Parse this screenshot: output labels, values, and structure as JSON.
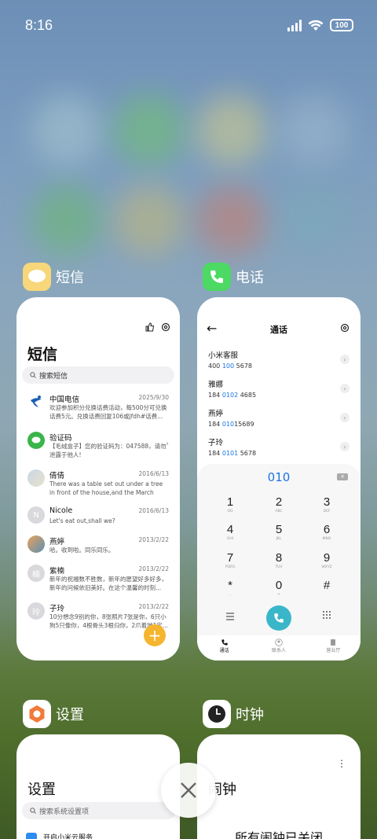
{
  "status_bar": {
    "time": "8:16",
    "battery": "100"
  },
  "apps": [
    {
      "name": "短信",
      "icon": "message-icon",
      "screen": {
        "title": "短信",
        "search_placeholder": "搜索短信",
        "messages": [
          {
            "name": "中国电信",
            "date": "2025/9/30",
            "preview": "欢迎参加积分兑换话费活动，每500分可兑换话费5元。兑换话费回复106或jfdh#话费..."
          },
          {
            "name": "验证码",
            "date": "",
            "preview": "【毛绒盒子】您的验证码为：047588，请勿泄露于他人!"
          },
          {
            "name": "倩倩",
            "date": "2016/6/13",
            "preview": "There was a table set out under a tree in front of the house,and the March Hare an..."
          },
          {
            "name": "Nicole",
            "date": "2016/6/13",
            "preview": "Let's eat out,shall we?"
          },
          {
            "name": "燕婷",
            "date": "2013/2/22",
            "preview": "哈。收到啦。同乐同乐。"
          },
          {
            "name": "紫楠",
            "date": "2013/2/22",
            "preview": "新年的祝福数不胜数，新年的愿望好多好多，新年的问候依旧美好。在这个温馨的时刻..."
          },
          {
            "name": "子玲",
            "date": "2013/2/22",
            "preview": "10分想念9别的你，8张照片7张是你，6只小狗5只像你，4根骨头3根归你，2爪着地1定..."
          }
        ],
        "avatar_initials": {
          "nicole": "N",
          "zinan": "楠",
          "ziling": "玲"
        }
      }
    },
    {
      "name": "电话",
      "icon": "phone-icon",
      "screen": {
        "title": "通话",
        "contacts": [
          {
            "name": "小米客服",
            "pre": "400 ",
            "hl": "100",
            "post": " 5678"
          },
          {
            "name": "雅娜",
            "pre": "184 ",
            "hl": "0102",
            "post": " 4685"
          },
          {
            "name": "燕婷",
            "pre": "184 ",
            "hl": "010",
            "post": "15689"
          },
          {
            "name": "子玲",
            "pre": "184 ",
            "hl": "0101",
            "post": " 5678"
          }
        ],
        "dialed": "010",
        "keys": [
          {
            "d": "1",
            "l": "QO"
          },
          {
            "d": "2",
            "l": "ABC"
          },
          {
            "d": "3",
            "l": "DEF"
          },
          {
            "d": "4",
            "l": "GHI"
          },
          {
            "d": "5",
            "l": "JKL"
          },
          {
            "d": "6",
            "l": "MNO"
          },
          {
            "d": "7",
            "l": "PQRS"
          },
          {
            "d": "8",
            "l": "TUV"
          },
          {
            "d": "9",
            "l": "WXYZ"
          },
          {
            "d": "*",
            "l": ","
          },
          {
            "d": "0",
            "l": "+"
          },
          {
            "d": "#",
            "l": ""
          }
        ],
        "tabs": [
          "通话",
          "联系人",
          "营业厅"
        ]
      }
    },
    {
      "name": "设置",
      "icon": "settings-icon",
      "screen": {
        "title": "设置",
        "search_placeholder": "搜索系统设置项",
        "first_row": "开启小米云服务"
      }
    },
    {
      "name": "时钟",
      "icon": "clock-icon",
      "screen": {
        "title": "闹钟",
        "status": "所有闹钟已关闭"
      }
    }
  ],
  "colors": {
    "accent_blue": "#1b74e4",
    "fab": "#f5b52e",
    "call_button": "#3ab6c9",
    "message_icon_bg": "#f7d77a",
    "phone_icon_bg": "#4cd964"
  }
}
